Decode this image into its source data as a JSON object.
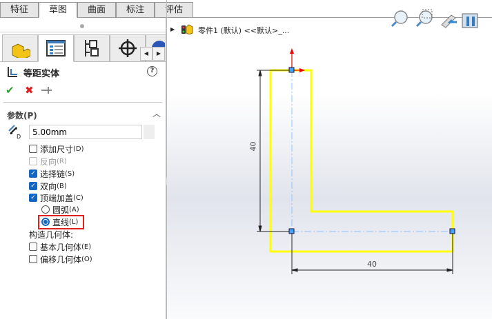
{
  "tabs": [
    "特征",
    "草图",
    "曲面",
    "标注",
    "评估"
  ],
  "active_tab": "草图",
  "feature": {
    "title": "等距实体",
    "ok": "✔",
    "cancel": "✖",
    "help": "?"
  },
  "params": {
    "section": "参数(P)",
    "distance": "5.00mm",
    "add_dim": "添加尺寸",
    "add_dim_key": "(D)",
    "reverse": "反向",
    "reverse_key": "(R)",
    "select_chain": "选择链",
    "select_chain_key": "(S)",
    "bidirectional": "双向",
    "bidirectional_key": "(B)",
    "cap_ends": "顶端加盖",
    "cap_ends_key": "(C)",
    "arc": "圆弧",
    "arc_key": "(A)",
    "line": "直线",
    "line_key": "(L)",
    "construction": "构造几何体:",
    "base_geom": "基本几何体",
    "base_geom_key": "(E)",
    "offset_geom": "偏移几何体",
    "offset_geom_key": "(O)"
  },
  "tree": {
    "part": "零件1 (默认) <<默认>_..."
  },
  "dims": {
    "vertical": "40",
    "horizontal": "40"
  },
  "colors": {
    "sketch": "#ffff00",
    "highlight": "#e02020",
    "accent": "#1366c2"
  }
}
